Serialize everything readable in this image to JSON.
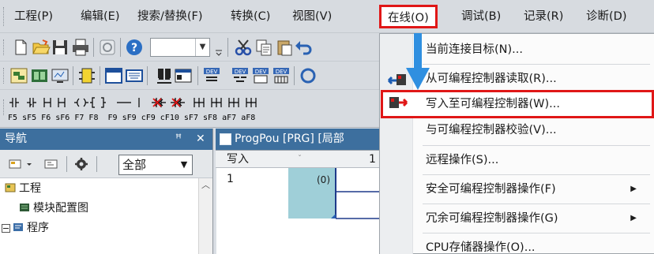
{
  "menubar": {
    "items": [
      {
        "label": "工程(P)"
      },
      {
        "label": "编辑(E)"
      },
      {
        "label": "搜索/替换(F)"
      },
      {
        "label": "转换(C)"
      },
      {
        "label": "视图(V)"
      },
      {
        "label": "在线(O)",
        "active": true
      },
      {
        "label": "调试(B)"
      },
      {
        "label": "记录(R)"
      },
      {
        "label": "诊断(D)"
      }
    ]
  },
  "toolbar_ladder": {
    "keys": [
      "F5",
      "sF5",
      "F6",
      "sF6",
      "F7",
      "F8",
      "F9",
      "sF9",
      "cF9",
      "cF10",
      "sF7",
      "sF8",
      "aF7",
      "aF8"
    ]
  },
  "navigation": {
    "title": "导航",
    "pin_icon": "pin-icon",
    "close_icon": "close-icon",
    "filter_combo_value": "全部",
    "tree": [
      {
        "label": "工程",
        "icon": "project-icon"
      },
      {
        "label": "模块配置图",
        "icon": "module-config-icon"
      },
      {
        "label": "程序",
        "icon": "program-icon",
        "expanded": true
      }
    ]
  },
  "editor": {
    "tab_title": "ProgPou [PRG] [局部",
    "mode_label": "写入",
    "column_index": "1",
    "row_number": "1",
    "step_label": "(0)"
  },
  "online_menu": {
    "items": [
      {
        "label": "当前连接目标(N)...",
        "icon": "",
        "has_submenu": false
      },
      {
        "label": "从可编程控制器读取(R)...",
        "icon": "plc-read-icon",
        "has_submenu": false
      },
      {
        "label": "写入至可编程控制器(W)...",
        "icon": "plc-write-icon",
        "has_submenu": false,
        "highlighted": true
      },
      {
        "label": "与可编程控制器校验(V)...",
        "icon": "",
        "has_submenu": false
      },
      {
        "label": "远程操作(S)...",
        "icon": "",
        "has_submenu": false
      },
      {
        "label": "安全可编程控制器操作(F)",
        "icon": "",
        "has_submenu": true
      },
      {
        "label": "冗余可编程控制器操作(G)",
        "icon": "",
        "has_submenu": true
      },
      {
        "label": "CPU存储器操作(O)...",
        "icon": "",
        "has_submenu": false
      }
    ],
    "submenu_arrow": "▶"
  },
  "colors": {
    "highlight_border": "#e01717",
    "pane_header": "#3d6f9e",
    "guide_arrow": "#2f8fe0"
  }
}
